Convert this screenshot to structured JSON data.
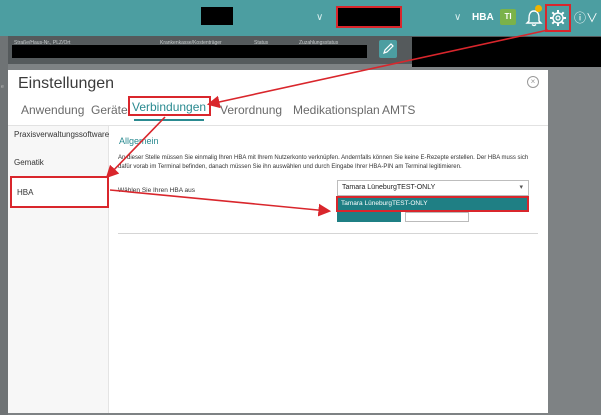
{
  "topbar": {
    "hba_label": "HBA",
    "ti_label": "TI",
    "icons": [
      "chevron-down-icon",
      "bell-icon",
      "gear-icon",
      "help-icon"
    ]
  },
  "patient_strip": {
    "labels": [
      "Straße/Haus-Nr., PLZ/Ort",
      "Krankenkasse/Kostenträger",
      "Status",
      "Zuzahlungsstatus"
    ]
  },
  "dialog": {
    "title": "Einstellungen",
    "tabs": [
      "Anwendung",
      "Geräte",
      "Verbindungen",
      "Verordnung",
      "Medikationsplan",
      "AMTS"
    ],
    "active_tab": "Verbindungen",
    "sidebar": [
      "Praxisverwaltungssoftware",
      "Gematik",
      "HBA"
    ],
    "active_sidebar": "HBA",
    "section_heading": "Allgemein",
    "description": "An dieser Stelle müssen Sie einmalig Ihren HBA mit Ihrem Nutzerkonto verknüpfen. Andernfalls können Sie keine E-Rezepte erstellen. Der HBA muss sich dafür vorab im Terminal befinden, danach müssen Sie ihn auswählen und durch Eingabe Ihrer HBA-PIN am Terminal legitimieren.",
    "field_label": "Wählen Sie Ihren HBA aus",
    "select_value": "Tamara LüneburgTEST-ONLY",
    "options": [
      "Tamara LüneburgTEST-ONLY"
    ]
  },
  "colors": {
    "teal": "#4c9ea1",
    "accent": "#1f7f84",
    "annotation_red": "#d9262c"
  }
}
